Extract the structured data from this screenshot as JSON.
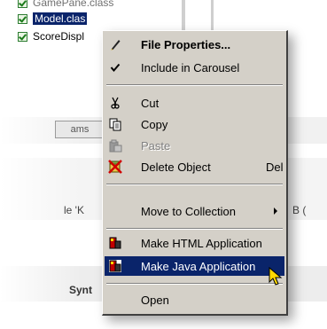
{
  "tree": {
    "items": [
      {
        "label": "GamePane.class",
        "selected": false
      },
      {
        "label": "Model.clas",
        "selected": true
      },
      {
        "label": "ScoreDispl",
        "selected": false
      }
    ]
  },
  "background": {
    "button_label": "ams",
    "left_text": "le 'K",
    "right_text": "B (",
    "bottom_text": "Synt"
  },
  "context_menu": {
    "items": [
      {
        "label": "File Properties...",
        "icon": "pencil-icon",
        "bold": true
      },
      {
        "label": "Include in Carousel",
        "icon": "check-icon",
        "checked": true
      },
      {
        "label": "Cut",
        "icon": "scissors-icon"
      },
      {
        "label": "Copy",
        "icon": "copy-icon"
      },
      {
        "label": "Paste",
        "icon": "paste-icon",
        "disabled": true
      },
      {
        "label": "Delete Object",
        "icon": "delete-icon",
        "shortcut": "Del"
      },
      {
        "label": "Move to Collection",
        "submenu": true
      },
      {
        "label": "Make HTML Application",
        "icon": "html-app-icon"
      },
      {
        "label": "Make Java Application",
        "icon": "java-app-icon",
        "highlighted": true
      },
      {
        "label": "Open"
      }
    ]
  },
  "colors": {
    "menu_bg": "#d4d0c8",
    "highlight": "#0a246a",
    "selected_tree": "#0a246a"
  }
}
